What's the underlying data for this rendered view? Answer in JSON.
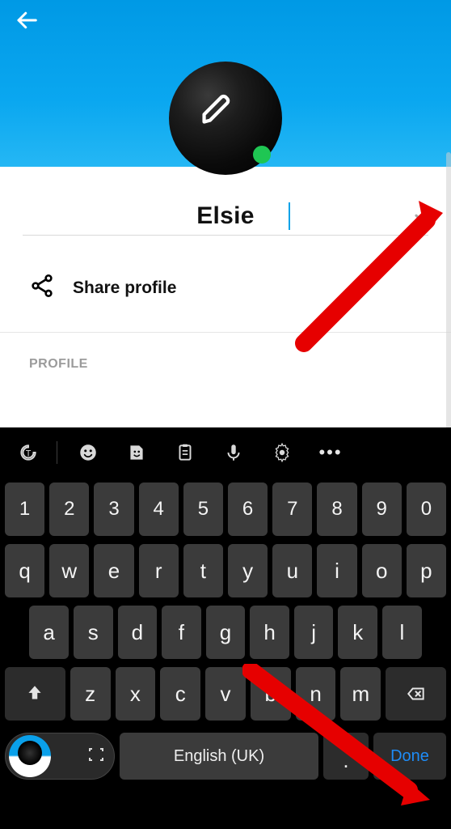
{
  "header": {
    "back_icon": "arrow-left"
  },
  "avatar": {
    "edit_icon": "pencil",
    "online": true
  },
  "name_field": {
    "value": "Elsie",
    "confirm_icon": "check"
  },
  "share_row": {
    "icon": "share",
    "label": "Share profile"
  },
  "sections": {
    "profile_label": "PROFILE"
  },
  "keyboard": {
    "toolbar": {
      "items": [
        "text-rotate",
        "divider",
        "emoji",
        "sticker",
        "clipboard",
        "mic",
        "settings",
        "more"
      ]
    },
    "rows": {
      "numbers": [
        "1",
        "2",
        "3",
        "4",
        "5",
        "6",
        "7",
        "8",
        "9",
        "0"
      ],
      "row1": [
        "q",
        "w",
        "e",
        "r",
        "t",
        "y",
        "u",
        "i",
        "o",
        "p"
      ],
      "row2": [
        "a",
        "s",
        "d",
        "f",
        "g",
        "h",
        "j",
        "k",
        "l"
      ],
      "row3": [
        "z",
        "x",
        "c",
        "v",
        "b",
        "n",
        "m"
      ]
    },
    "space_label": "English (UK)",
    "period_label": ".",
    "action_label": "Done"
  },
  "annotations": {
    "arrow_top_target": "confirm-name-button",
    "arrow_bottom_target": "keyboard-done-button",
    "arrow_color": "#e60000"
  }
}
